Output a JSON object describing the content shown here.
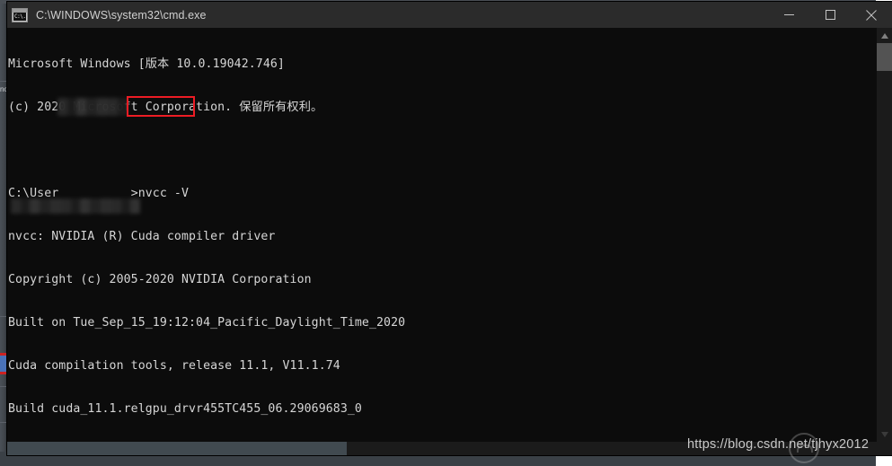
{
  "window": {
    "title": "C:\\WINDOWS\\system32\\cmd.exe",
    "icon": "cmd-console-icon",
    "icon_glyph": "C:\\.",
    "controls": {
      "minimize": "minimize-button",
      "maximize": "maximize-button",
      "close": "close-button"
    }
  },
  "terminal": {
    "background_color": "#0c0c0c",
    "foreground_color": "#d6d6d6",
    "lines": [
      "Microsoft Windows [版本 10.0.19042.746]",
      "(c) 2020 Microsoft Corporation. 保留所有权利。",
      "",
      "C:\\User",
      "nvcc: NVIDIA (R) Cuda compiler driver",
      "Copyright (c) 2005-2020 NVIDIA Corporation",
      "Built on Tue_Sep_15_19:12:04_Pacific_Daylight_Time_2020",
      "Cuda compilation tools, release 11.1, V11.1.74",
      "Build cuda_11.1.relgpu_drvr455TC455_06.29069683_0"
    ],
    "prompt_prefix": "C:\\User",
    "command": ">nvcc -V",
    "redacted_username": "",
    "redacted_path": ""
  },
  "annotation": {
    "highlight_color": "#ed1c24",
    "highlight_target": ">nvcc -V"
  },
  "scrollbars": {
    "vertical_up_arrow": "▲",
    "vertical_down_arrow": "▼"
  },
  "watermark": {
    "text": "https://blog.csdn.net/tjhyx2012",
    "logo": "csdn-logo"
  },
  "background": {
    "side_label": "no"
  }
}
